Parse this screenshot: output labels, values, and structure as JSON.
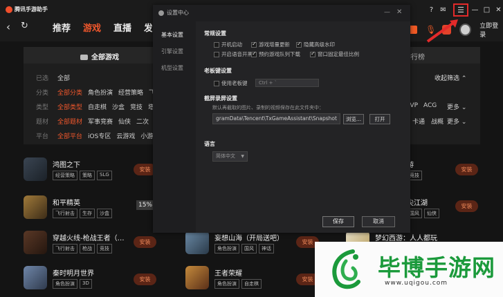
{
  "app": {
    "title": "腾讯手游助手"
  },
  "nav": {
    "tabs": [
      "推荐",
      "游戏",
      "直播",
      "发"
    ],
    "active_index": 1
  },
  "window_controls": {
    "help": "?",
    "mail": "✉",
    "menu": "☰",
    "minimize": "—",
    "maximize": "□",
    "close": "✕"
  },
  "account": {
    "login": "立即登录"
  },
  "filter": {
    "header": "全部游戏",
    "rank_tab": "排行榜",
    "collapse": "收起筛选",
    "rows": [
      {
        "key": "已选",
        "items": [
          "全部"
        ]
      },
      {
        "key": "分类",
        "items": [
          "全部分类",
          "角色扮演",
          "经营策略",
          "飞"
        ]
      },
      {
        "key": "类型",
        "items": [
          "全部类型",
          "自走棋",
          "沙盒",
          "竞技",
          "塔"
        ]
      },
      {
        "key": "题材",
        "items": [
          "全部题材",
          "军事竞赛",
          "仙侠",
          "二次"
        ]
      },
      {
        "key": "平台",
        "items": [
          "全部平台",
          "iOS专区",
          "云游戏",
          "小游"
        ]
      }
    ],
    "right_row2": [
      "PVP",
      "ACG",
      "更多"
    ],
    "right_row3": [
      "卡通",
      "战概",
      "更多"
    ]
  },
  "games": [
    {
      "name": "鸿图之下",
      "tags": [
        "经营策略",
        "策略",
        "SLG"
      ],
      "install": "安装"
    },
    {
      "name": "和平精英",
      "tags": [
        "飞行射击",
        "生存",
        "沙盒"
      ],
      "progress": "15%"
    },
    {
      "name": "穿越火线-枪战王者（…",
      "tags": [
        "飞行射击",
        "枪战",
        "竞技"
      ],
      "install": "安装"
    },
    {
      "name": "秦时明月世界",
      "tags": [
        "角色扮演",
        "3D"
      ],
      "install": "安装"
    },
    {
      "name": "妄想山海（开局送吧）",
      "tags": [
        "角色扮演",
        "国风",
        "神话"
      ],
      "install": "安装"
    },
    {
      "name": "王者荣耀",
      "tags": [
        "角色扮演",
        "自走棋"
      ],
      "install": "安装"
    },
    {
      "name": "游",
      "tags": [
        "竞技"
      ],
      "install": "安装"
    },
    {
      "name": "尖江湖",
      "tags": [
        "国风",
        "仙侠"
      ],
      "install": "安装"
    },
    {
      "name": "梦幻西游：人人都玩",
      "tags": []
    }
  ],
  "dialog": {
    "title": "设置中心",
    "sidebar": [
      "基本设置",
      "引擎设置",
      "机型设置"
    ],
    "sections": {
      "general": "常规设置",
      "boss_key": "老板键设置",
      "screenshot": "截屏录屏设置",
      "language": "语言"
    },
    "checkboxes": [
      {
        "label": "开机启动",
        "checked": false
      },
      {
        "label": "游戏增量更新",
        "checked": true
      },
      {
        "label": "隐藏高级水印",
        "checked": true
      },
      {
        "label": "开启语音开黑",
        "checked": false
      },
      {
        "label": "预约游戏队列下载",
        "checked": true
      },
      {
        "label": "窗口固定最佳比例",
        "checked": true
      }
    ],
    "boss_key": {
      "label": "使用老板键",
      "checked": false,
      "hotkey": "Ctrl + `"
    },
    "screenshot": {
      "hint": "默认再截取的图片、录制的视频保存在此文件夹中：",
      "path": "gramData\\Tencent\\TxGameAssistant\\Snapshot",
      "browse": "浏览...",
      "open": "打开"
    },
    "language": {
      "value": "简体中文"
    },
    "save": "保存",
    "cancel": "取消"
  },
  "watermark": {
    "text": "毕博手游网",
    "url": "www.uqigou.com"
  },
  "colors": {
    "accent": "#f0572c",
    "highlight": "#e32a2a",
    "watermark_green": "#1b9a3b"
  }
}
